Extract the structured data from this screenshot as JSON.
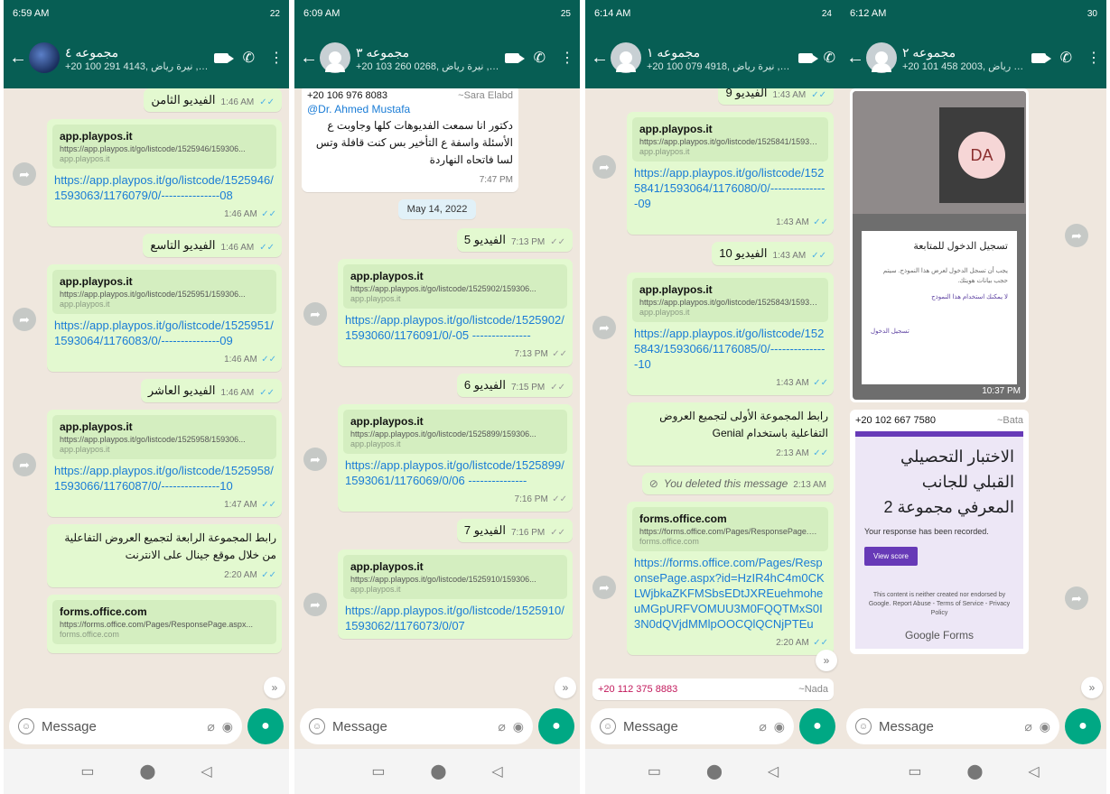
{
  "screens": [
    {
      "status_time": "6:59 AM",
      "status_right": "22",
      "group_name": "مجموعه ٤",
      "members": "+20 100 291 4143, نيرة رياض ,+...",
      "messages": [
        {
          "text": "الفيديو الثامن",
          "time": "1:46 AM"
        },
        {
          "preview_title": "app.playpos.it",
          "preview_url": "https://app.playpos.it/go/listcode/1525946/159306...",
          "preview_domain": "app.playpos.it",
          "link": "https://app.playpos.it/go/listcode/1525946/1593063/1176079/0/---------------08",
          "time": "1:46 AM"
        },
        {
          "text": "الفيديو التاسع",
          "time": "1:46 AM"
        },
        {
          "preview_title": "app.playpos.it",
          "preview_url": "https://app.playpos.it/go/listcode/1525951/159306...",
          "preview_domain": "app.playpos.it",
          "link": "https://app.playpos.it/go/listcode/1525951/1593064/1176083/0/---------------09",
          "time": "1:46 AM"
        },
        {
          "text": "الفيديو العاشر",
          "time": "1:46 AM"
        },
        {
          "preview_title": "app.playpos.it",
          "preview_url": "https://app.playpos.it/go/listcode/1525958/159306...",
          "preview_domain": "app.playpos.it",
          "link": "https://app.playpos.it/go/listcode/1525958/1593066/1176087/0/---------------10",
          "time": "1:47 AM"
        },
        {
          "text": "رابط المجموعة الرابعة لتجميع العروض التفاعلية من خلال موقع جينال على الانترنت",
          "time": "2:20 AM"
        },
        {
          "preview_title": "forms.office.com",
          "preview_url": "https://forms.office.com/Pages/ResponsePage.aspx...",
          "preview_domain": "forms.office.com"
        }
      ],
      "placeholder": "Message"
    },
    {
      "status_time": "6:09 AM",
      "status_right": "25",
      "group_name": "مجموعه ٣",
      "members": "+20 103 260 0268, نيرة رياض ,+...",
      "messages": [
        {
          "sender_number": "+20 106 976 8083",
          "sender_name": "~Sara Elabd",
          "mention": "@Dr. Ahmed Mustafa",
          "text": "دكتور انا سمعت الفديوهات كلها وجاوبت ع الأسئلة واسفة ع التأخير بس كنت قافلة وتس لسا فاتحاه النهاردة",
          "time": "7:47 PM"
        },
        {
          "date": "May 14, 2022"
        },
        {
          "text": "الفيديو 5",
          "time": "7:13 PM"
        },
        {
          "preview_title": "app.playpos.it",
          "preview_url": "https://app.playpos.it/go/listcode/1525902/159306...",
          "preview_domain": "app.playpos.it",
          "link": "https://app.playpos.it/go/listcode/1525902/1593060/1176091/0/-05 ---------------",
          "time": "7:13 PM"
        },
        {
          "text": "الفيديو 6",
          "time": "7:15 PM"
        },
        {
          "preview_title": "app.playpos.it",
          "preview_url": "https://app.playpos.it/go/listcode/1525899/159306...",
          "preview_domain": "app.playpos.it",
          "link": "https://app.playpos.it/go/listcode/1525899/1593061/1176069/0/06 ---------------",
          "time": "7:16 PM"
        },
        {
          "text": "الفيديو 7",
          "time": "7:16 PM"
        },
        {
          "preview_title": "app.playpos.it",
          "preview_url": "https://app.playpos.it/go/listcode/1525910/159306...",
          "preview_domain": "app.playpos.it",
          "link": "https://app.playpos.it/go/listcode/1525910/1593062/1176073/0/07"
        }
      ],
      "placeholder": "Message"
    },
    {
      "status_time": "6:14 AM",
      "status_right": "24",
      "group_name": "مجموعه ١",
      "members": "+20 100 079 4918, نيرة رياض ,+...",
      "messages": [
        {
          "text": "الفيديو 9",
          "time": "1:43 AM"
        },
        {
          "preview_title": "app.playpos.it",
          "preview_url": "https://app.playpos.it/go/listcode/1525841/159306...",
          "preview_domain": "app.playpos.it",
          "link": "https://app.playpos.it/go/listcode/1525841/1593064/1176080/0/---------------09",
          "time": "1:43 AM"
        },
        {
          "text": "الفيديو 10",
          "time": "1:43 AM"
        },
        {
          "preview_title": "app.playpos.it",
          "preview_url": "https://app.playpos.it/go/listcode/1525843/159306...",
          "preview_domain": "app.playpos.it",
          "link": "https://app.playpos.it/go/listcode/1525843/1593066/1176085/0/---------------10",
          "time": "1:43 AM"
        },
        {
          "text": "رابط المجموعة الأولى لتجميع العروض التفاعلية باستخدام Genial",
          "time": "2:13 AM"
        },
        {
          "deleted": "You deleted this message",
          "time": "2:13 AM"
        },
        {
          "preview_title": "forms.office.com",
          "preview_url": "https://forms.office.com/Pages/ResponsePage.aspx...",
          "preview_domain": "forms.office.com",
          "link": "https://forms.office.com/Pages/ResponsePage.aspx?id=HzIR4hC4m0CKLWjbkaZKFMSbsEDtJXREuehmoheuMGpURFVOMUU3M0FQQTMxS0I3N0dQVjdMMlpOOCQlQCNjPTEu",
          "time": "2:20 AM"
        },
        {
          "sender_number": "+20 112 375 8883",
          "sender_name": "~Nada"
        }
      ],
      "placeholder": "Message"
    },
    {
      "status_time": "6:12 AM",
      "status_right": "30",
      "group_name": "مجموعه ٢",
      "members": "+20 101 458 2003, نيرة رياض ,+...",
      "shot": {
        "avatar_initials": "DA",
        "heading": "تسجيل الدخول للمتابعة",
        "body": "يجب أن تسجل الدخول لعرض هذا النموذج. سيتم حجب بيانات هويتك.",
        "link": "لا يمكنك استخدام هذا النموذج",
        "foot": "تسجيل الدخول",
        "time": "10:37 PM"
      },
      "form": {
        "sender_number": "+20 102 667 7580",
        "sender_name": "~Bata",
        "title": "الاختبار التحصيلي القبلي للجانب المعرفي مجموعة 2",
        "response": "Your response has been recorded.",
        "button": "View score",
        "note": "This content is neither created nor endorsed by Google. Report Abuse - Terms of Service - Privacy Policy",
        "brand": "Google Forms"
      },
      "placeholder": "Message"
    }
  ],
  "colors": {
    "header": "#075e54",
    "outgoing": "#e3f9d0",
    "link": "#1a7cd6",
    "mic": "#00a884",
    "chat_bg": "#efe7de"
  }
}
